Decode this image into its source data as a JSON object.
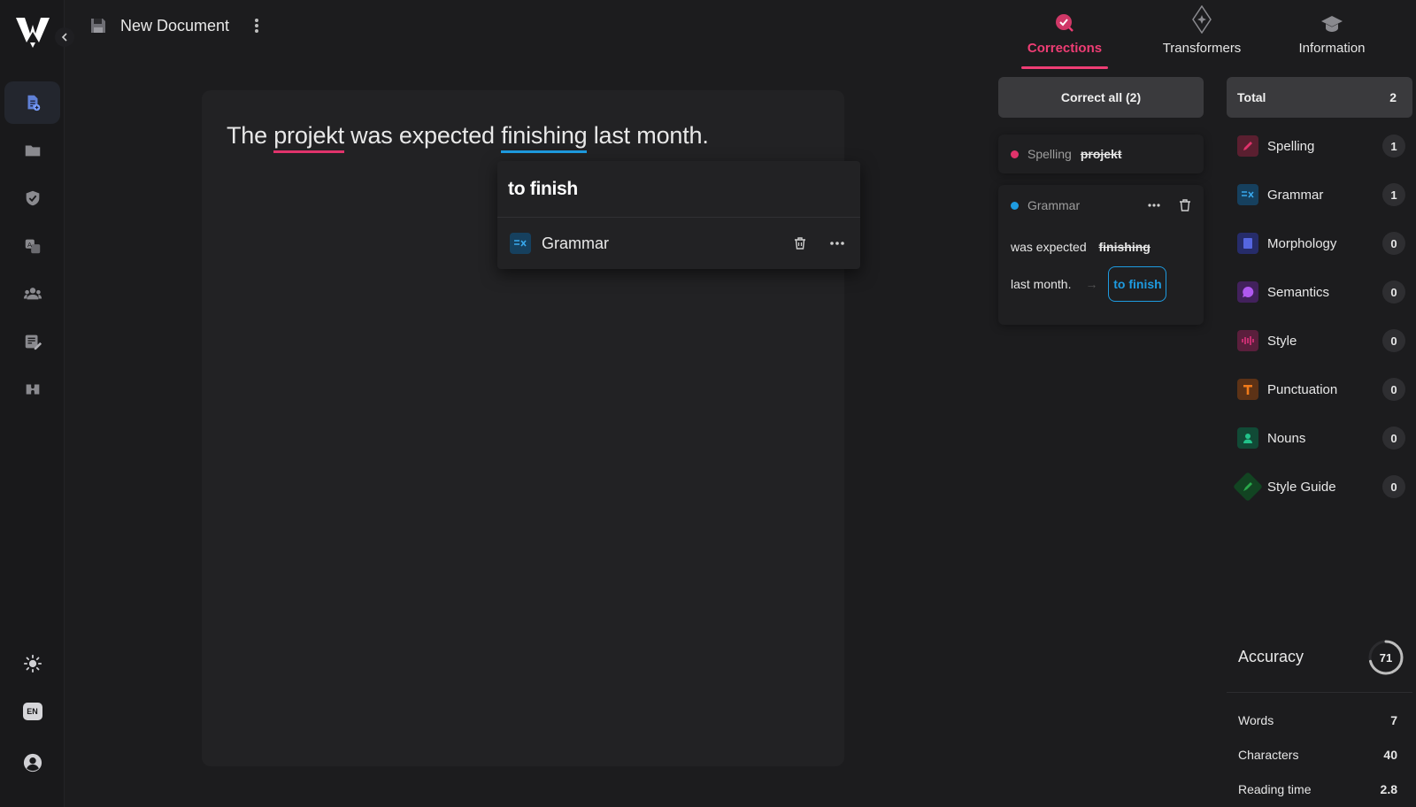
{
  "app": {
    "doc_title": "New Document",
    "lang_badge": "EN"
  },
  "editor": {
    "text_before": "The ",
    "spell_word": "projekt",
    "text_mid": " was expected ",
    "gram_word": "finishing",
    "text_after": " last month."
  },
  "popover": {
    "suggestion": "to finish",
    "category": "Grammar"
  },
  "tabs": [
    {
      "label": "Corrections",
      "active": true
    },
    {
      "label": "Transformers",
      "active": false
    },
    {
      "label": "Information",
      "active": false
    }
  ],
  "corrections": {
    "correct_all": "Correct all (2)",
    "spelling_card": {
      "category": "Spelling",
      "word": "projekt"
    },
    "grammar_card": {
      "category": "Grammar",
      "context_before": "was expected",
      "word": "finishing",
      "context_after": "last month.",
      "arrow": "→",
      "suggestion": "to finish"
    }
  },
  "summary": {
    "total_label": "Total",
    "total_count": "2",
    "categories": [
      {
        "label": "Spelling",
        "count": "1",
        "color": "#e0336b"
      },
      {
        "label": "Grammar",
        "count": "1",
        "color": "#1e9be0"
      },
      {
        "label": "Morphology",
        "count": "0",
        "color": "#4a5bd8"
      },
      {
        "label": "Semantics",
        "count": "0",
        "color": "#a84de6"
      },
      {
        "label": "Style",
        "count": "0",
        "color": "#e0337e"
      },
      {
        "label": "Punctuation",
        "count": "0",
        "color": "#f07a1a"
      },
      {
        "label": "Nouns",
        "count": "0",
        "color": "#22c28a"
      },
      {
        "label": "Style Guide",
        "count": "0",
        "color": "#29a84a"
      }
    ]
  },
  "accuracy": {
    "label": "Accuracy",
    "value": "71",
    "fraction": 0.71
  },
  "stats": [
    {
      "label": "Words",
      "value": "7"
    },
    {
      "label": "Characters",
      "value": "40"
    },
    {
      "label": "Reading time",
      "value": "2.8"
    }
  ]
}
